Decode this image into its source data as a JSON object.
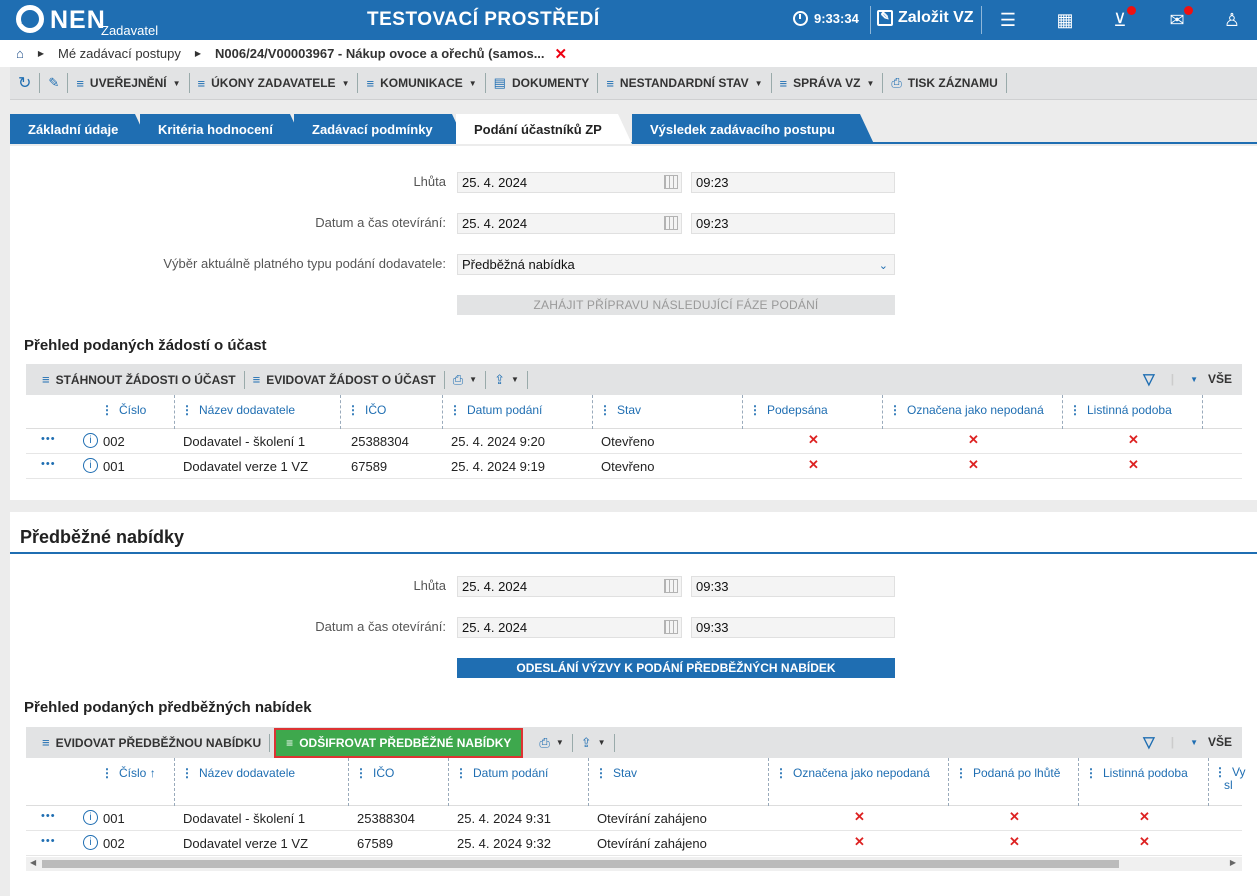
{
  "topbar": {
    "logo": "NEN",
    "logo_sub": "Zadavatel",
    "env_title": "TESTOVACÍ PROSTŘEDÍ",
    "time": "9:33:34",
    "create_label": "Založit VZ",
    "icons": [
      "clock-icon",
      "edit-icon",
      "menu-icon",
      "calculator-icon",
      "inbox-icon",
      "mail-icon",
      "user-icon"
    ]
  },
  "breadcrumb": {
    "items": [
      "Mé zadávací postupy",
      "N006/24/V00003967 - Nákup ovoce a ořechů (samos..."
    ]
  },
  "actionbar": {
    "items": [
      "UVEŘEJNĚNÍ",
      "ÚKONY ZADAVATELE",
      "KOMUNIKACE",
      "DOKUMENTY",
      "NESTANDARDNÍ STAV",
      "SPRÁVA VZ",
      "TISK ZÁZNAMU"
    ]
  },
  "tabs": [
    "Základní údaje",
    "Kritéria hodnocení",
    "Zadávací podmínky",
    "Podání účastníků ZP",
    "Výsledek zadávacího postupu"
  ],
  "form1": {
    "deadline_label": "Lhůta",
    "deadline_date": "25. 4. 2024",
    "deadline_time": "09:23",
    "open_label": "Datum a čas otevírání:",
    "open_date": "25. 4. 2024",
    "open_time": "09:23",
    "type_label": "Výběr aktuálně platného typu podání dodavatele:",
    "type_value": "Předběžná nabídka",
    "next_phase_button": "ZAHÁJIT PŘÍPRAVU NÁSLEDUJÍCÍ FÁZE PODÁNÍ"
  },
  "grid1": {
    "title": "Přehled podaných žádostí o účast",
    "toolbar": [
      "STÁHNOUT ŽÁDOSTI O ÚČAST",
      "EVIDOVAT ŽÁDOST O ÚČAST"
    ],
    "all_label": "VŠE",
    "columns": [
      "Číslo",
      "Název dodavatele",
      "IČO",
      "Datum podání",
      "Stav",
      "Podepsána",
      "Označena jako nepodaná",
      "Listinná podoba"
    ],
    "rows": [
      {
        "cislo": "002",
        "nazev": "Dodavatel - školení 1",
        "ico": "25388304",
        "datum": "25. 4. 2024 9:20",
        "stav": "Otevřeno"
      },
      {
        "cislo": "001",
        "nazev": "Dodavatel verze 1 VZ",
        "ico": "67589",
        "datum": "25. 4. 2024 9:19",
        "stav": "Otevřeno"
      }
    ]
  },
  "section2": {
    "title": "Předběžné nabídky",
    "deadline_label": "Lhůta",
    "deadline_date": "25. 4. 2024",
    "deadline_time": "09:33",
    "open_label": "Datum a čas otevírání:",
    "open_date": "25. 4. 2024",
    "open_time": "09:33",
    "send_button": "ODESLÁNÍ VÝZVY K PODÁNÍ PŘEDBĚŽNÝCH NABÍDEK"
  },
  "grid2": {
    "title": "Přehled podaných předběžných nabídek",
    "toolbar_evidovat": "EVIDOVAT PŘEDBĚŽNOU NABÍDKU",
    "toolbar_decrypt": "ODŠIFROVAT PŘEDBĚŽNÉ NABÍDKY",
    "all_label": "VŠE",
    "columns": [
      "Číslo",
      "Název dodavatele",
      "IČO",
      "Datum podání",
      "Stav",
      "Označena jako nepodaná",
      "Podaná po lhůtě",
      "Listinná podoba",
      "Vy",
      "sl"
    ],
    "sort_arrow": "↑",
    "rows": [
      {
        "cislo": "001",
        "nazev": "Dodavatel - školení 1",
        "ico": "25388304",
        "datum": "25. 4. 2024 9:31",
        "stav": "Otevírání zahájeno"
      },
      {
        "cislo": "002",
        "nazev": "Dodavatel verze 1 VZ",
        "ico": "67589",
        "datum": "25. 4. 2024 9:32",
        "stav": "Otevírání zahájeno"
      }
    ]
  },
  "colors": {
    "brand": "#1f6eb2",
    "green": "#3ea84d",
    "red": "#dd2222"
  }
}
